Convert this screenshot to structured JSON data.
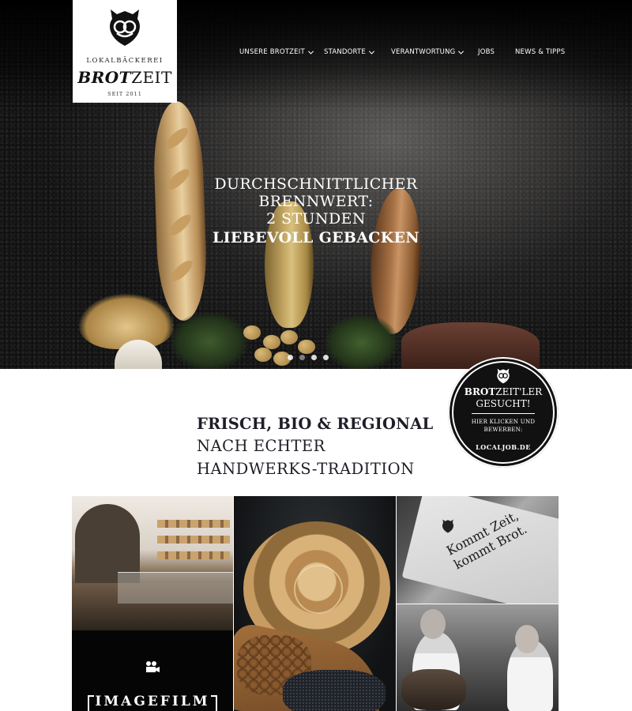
{
  "brand": {
    "subtitle": "LOKALBÄCKEREI",
    "name_bold": "BROT",
    "name_regular": "ZEIT",
    "since": "SEIT 2011"
  },
  "nav": {
    "items": [
      {
        "label": "UNSERE BROTZEIT",
        "has_dropdown": true
      },
      {
        "label": "STANDORTE",
        "has_dropdown": true
      },
      {
        "label": "VERANTWORTUNG",
        "has_dropdown": true
      },
      {
        "label": "JOBS",
        "has_dropdown": false
      },
      {
        "label": "NEWS & TIPPS",
        "has_dropdown": false
      }
    ]
  },
  "hero": {
    "line1": "DURCHSCHNITTLICHER",
    "line2": "BRENNWERT:",
    "line3": "2 STUNDEN",
    "line4": "LIEBEVOLL GEBACKEN",
    "slides": 4,
    "active_slide": 2
  },
  "badge": {
    "title_bold": "BROT",
    "title_rest": "ZEIT'LER",
    "title2": "GESUCHT!",
    "cta_line1": "HIER KLICKEN UND",
    "cta_line2": "BEWERBEN:",
    "site": "LOCALJOB.DE"
  },
  "intro": {
    "line1": "FRISCH, BIO & REGIONAL",
    "line2": "NACH ECHTER",
    "line3": "HANDWERKS-TRADITION"
  },
  "tiles": {
    "film_label": "IMAGEFILM",
    "bag_line1": "Kommt Zeit,",
    "bag_line2": "kommt Brot."
  },
  "colors": {
    "hero_bg": "#1d1c1c",
    "text_dark": "#1e1e28",
    "badge_bg": "#111111",
    "white": "#ffffff"
  },
  "icons": [
    "pretzel-emblem-icon",
    "chevron-down-icon",
    "film-camera-icon"
  ]
}
